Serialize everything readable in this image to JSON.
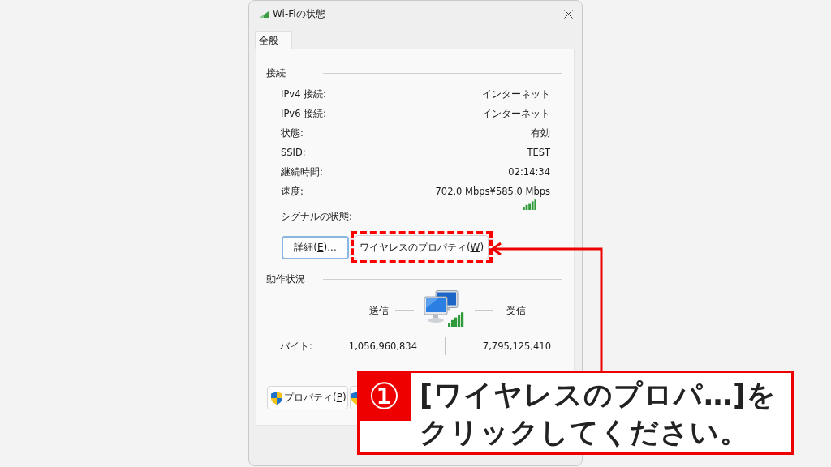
{
  "window": {
    "title": "Wi-Fiの状態"
  },
  "tabs": [
    {
      "label": "全般",
      "selected": true
    }
  ],
  "connection": {
    "heading": "接続",
    "rows": [
      {
        "label": "IPv4 接続:",
        "value": "インターネット"
      },
      {
        "label": "IPv6 接続:",
        "value": "インターネット"
      },
      {
        "label": "状態:",
        "value": "有効"
      },
      {
        "label": "SSID:",
        "value": "TEST"
      },
      {
        "label": "継続時間:",
        "value": "02:14:34"
      },
      {
        "label": "速度:",
        "value": "702.0 Mbps¥585.0 Mbps"
      }
    ],
    "signal_label": "シグナルの状態:"
  },
  "connection_buttons": [
    {
      "label_before_key": "詳細(",
      "access_key": "E",
      "label_after_key": ")...",
      "focused": true,
      "highlighted": false
    },
    {
      "label_before_key": "ワイヤレスのプロパティ(",
      "access_key": "W",
      "label_after_key": ")",
      "focused": false,
      "highlighted": true
    }
  ],
  "activity": {
    "heading": "動作状況",
    "sent_label": "送信",
    "received_label": "受信",
    "rows": [
      {
        "label": "バイト:",
        "sent": "1,056,960,834",
        "received": "7,795,125,410"
      }
    ]
  },
  "bottom_buttons": [
    {
      "label_before_key": "プロパティ(",
      "access_key": "P",
      "label_after_key": ")",
      "shield": true
    },
    {
      "shield": true
    }
  ],
  "callout": {
    "badge": "①",
    "text": "[ワイヤレスのプロパ…]をクリックしてください。"
  }
}
